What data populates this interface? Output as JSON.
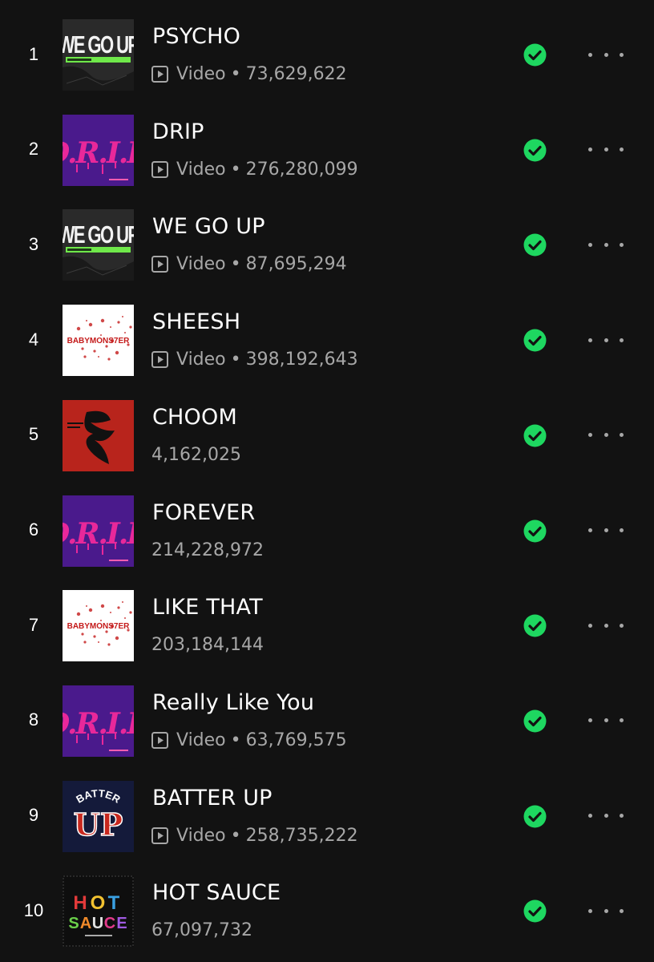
{
  "tracks": [
    {
      "rank": "1",
      "title": "PSYCHO",
      "has_video": true,
      "video_label": "Video",
      "plays": "73,629,622",
      "cover": "we-go-up-cover",
      "cover_text": "WE GO UP"
    },
    {
      "rank": "2",
      "title": "DRIP",
      "has_video": true,
      "video_label": "Video",
      "plays": "276,280,099",
      "cover": "drip-cover",
      "cover_text": "DRIP"
    },
    {
      "rank": "3",
      "title": "WE GO UP",
      "has_video": true,
      "video_label": "Video",
      "plays": "87,695,294",
      "cover": "we-go-up-cover",
      "cover_text": "WE GO UP"
    },
    {
      "rank": "4",
      "title": "SHEESH",
      "has_video": true,
      "video_label": "Video",
      "plays": "398,192,643",
      "cover": "babymonster-cover",
      "cover_text": "BABYMONS7ER"
    },
    {
      "rank": "5",
      "title": "CHOOM",
      "has_video": false,
      "video_label": "",
      "plays": "4,162,025",
      "cover": "choom-cover",
      "cover_text": ""
    },
    {
      "rank": "6",
      "title": "FOREVER",
      "has_video": false,
      "video_label": "",
      "plays": "214,228,972",
      "cover": "drip-cover",
      "cover_text": "DRIP"
    },
    {
      "rank": "7",
      "title": "LIKE THAT",
      "has_video": false,
      "video_label": "",
      "plays": "203,184,144",
      "cover": "babymonster-cover",
      "cover_text": "BABYMONS7ER"
    },
    {
      "rank": "8",
      "title": "Really Like You",
      "has_video": true,
      "video_label": "Video",
      "plays": "63,769,575",
      "cover": "drip-cover",
      "cover_text": "DRIP"
    },
    {
      "rank": "9",
      "title": "BATTER UP",
      "has_video": true,
      "video_label": "Video",
      "plays": "258,735,222",
      "cover": "batter-up-cover",
      "cover_text": "BATTER UP"
    },
    {
      "rank": "10",
      "title": "HOT SAUCE",
      "has_video": false,
      "video_label": "",
      "plays": "67,097,732",
      "cover": "hot-sauce-cover",
      "cover_text": "HOT SAUCE"
    }
  ],
  "separator": "•",
  "colors": {
    "background": "#121212",
    "text_primary": "#ffffff",
    "text_secondary": "#a7a7a7",
    "check_green": "#1ed760",
    "drip_purple": "#4a1a8c",
    "drip_pink": "#e8289a",
    "choom_red": "#b8241c",
    "batter_navy": "#141a3a",
    "batter_red": "#c8281e"
  },
  "icons": {
    "saved": "check-circle-icon",
    "more": "more-options-icon",
    "video": "video-play-icon"
  }
}
